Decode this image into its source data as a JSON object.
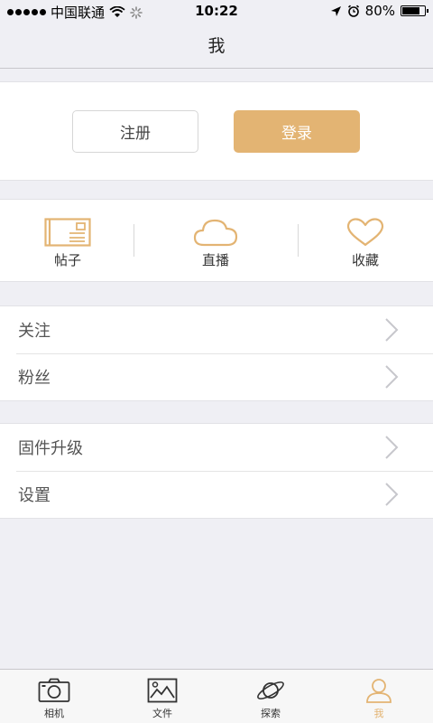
{
  "status_bar": {
    "carrier": "中国联通",
    "time": "10:22",
    "battery": "80%",
    "battery_level": 0.8
  },
  "nav": {
    "title": "我"
  },
  "auth": {
    "register_label": "注册",
    "login_label": "登录"
  },
  "stats": [
    {
      "label": "帖子",
      "icon": "postcard-icon"
    },
    {
      "label": "直播",
      "icon": "cloud-icon"
    },
    {
      "label": "收藏",
      "icon": "heart-icon"
    }
  ],
  "list1": [
    {
      "label": "关注"
    },
    {
      "label": "粉丝"
    }
  ],
  "list2": [
    {
      "label": "固件升级"
    },
    {
      "label": "设置"
    }
  ],
  "tabs": [
    {
      "label": "相机",
      "icon": "camera-icon"
    },
    {
      "label": "文件",
      "icon": "image-icon"
    },
    {
      "label": "探索",
      "icon": "planet-icon"
    },
    {
      "label": "我",
      "icon": "user-icon",
      "active": true
    }
  ],
  "colors": {
    "accent": "#e3b473",
    "background": "#efeff4"
  }
}
